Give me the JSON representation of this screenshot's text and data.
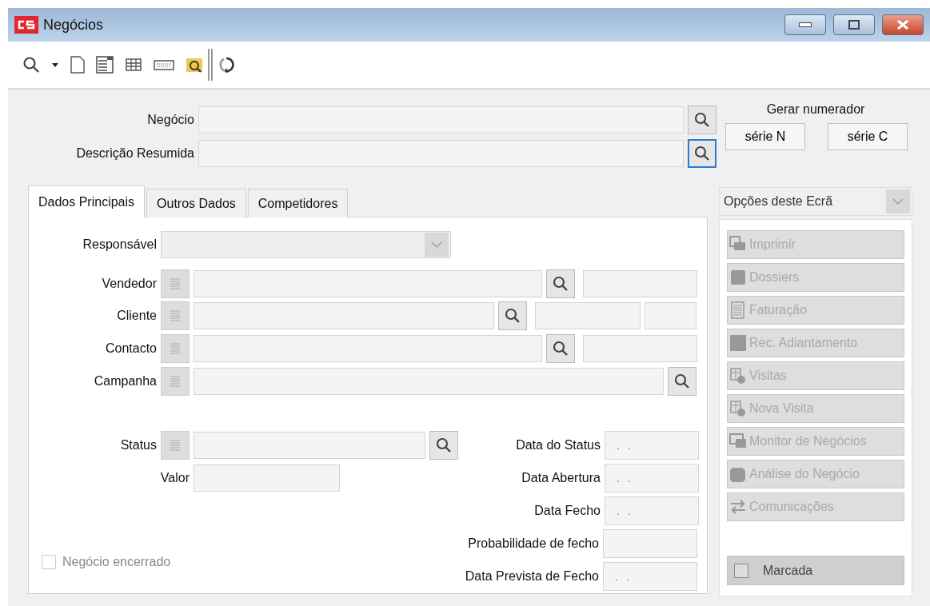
{
  "window": {
    "title": "Negócios"
  },
  "header_fields": [
    {
      "label": "Negócio",
      "focused": false
    },
    {
      "label": "Descrição Resumida",
      "focused": true
    }
  ],
  "numerator": {
    "title": "Gerar numerador",
    "buttons": [
      "série N",
      "série C"
    ]
  },
  "tabs": [
    {
      "label": "Dados Principais",
      "selected": true
    },
    {
      "label": "Outros Dados",
      "selected": false
    },
    {
      "label": "Competidores",
      "selected": false
    }
  ],
  "responsible": {
    "label": "Responsável"
  },
  "lookups": [
    {
      "label": "Vendedor",
      "kind": "code"
    },
    {
      "label": "Cliente",
      "kind": "split"
    },
    {
      "label": "Contacto",
      "kind": "code"
    },
    {
      "label": "Campanha",
      "kind": "plain"
    }
  ],
  "status": {
    "label": "Status"
  },
  "amount": {
    "label": "Valor"
  },
  "dates": [
    {
      "label": "Data do Status",
      "value": ". ."
    },
    {
      "label": "Data Abertura",
      "value": ". ."
    },
    {
      "label": "Data Fecho",
      "value": ". ."
    },
    {
      "label": "Probabilidade de fecho"
    },
    {
      "label": "Data Prevista de Fecho",
      "value": ". ."
    }
  ],
  "closed_checkbox": {
    "label": "Negócio encerrado",
    "checked": false,
    "disabled": true
  },
  "options": {
    "title": "Opções deste Ecrã",
    "buttons": [
      {
        "label": "Imprimir",
        "disabled": true
      },
      {
        "label": "Dossiers",
        "disabled": true
      },
      {
        "label": "Faturação",
        "disabled": true
      },
      {
        "label": "Rec. Adiantamento",
        "disabled": true
      },
      {
        "label": "Visitas",
        "disabled": true
      },
      {
        "label": "Nova Visita",
        "disabled": true
      },
      {
        "label": "Monitor de Negócios",
        "disabled": true
      },
      {
        "label": "Análise do Negócio",
        "disabled": true
      },
      {
        "label": "Comunicações",
        "disabled": true
      }
    ]
  },
  "marked": {
    "label": "Marcada",
    "checked": false
  }
}
